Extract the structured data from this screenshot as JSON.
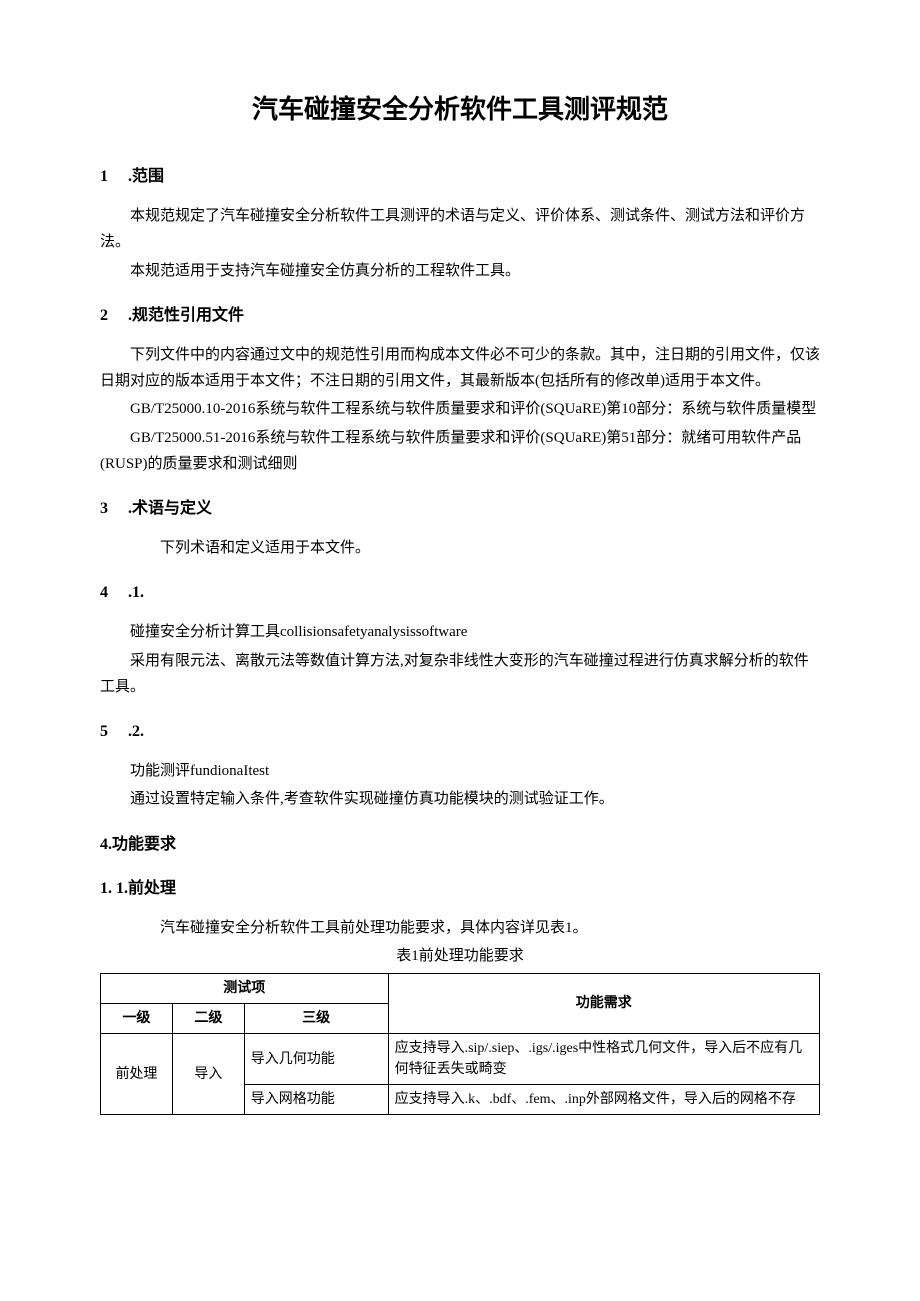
{
  "title": "汽车碰撞安全分析软件工具测评规范",
  "s1": {
    "num": "1",
    "headgap": ".",
    "head": "范围",
    "p1": "本规范规定了汽车碰撞安全分析软件工具测评的术语与定义、评价体系、测试条件、测试方法和评价方法。",
    "p2": "本规范适用于支持汽车碰撞安全仿真分析的工程软件工具。"
  },
  "s2": {
    "num": "2",
    "headgap": ".",
    "head": "规范性引用文件",
    "p1": "下列文件中的内容通过文中的规范性引用而构成本文件必不可少的条款。其中，注日期的引用文件，仅该日期对应的版本适用于本文件；不注日期的引用文件，其最新版本(包括所有的修改单)适用于本文件。",
    "p2": "GB/T25000.10-2016系统与软件工程系统与软件质量要求和评价(SQUaRE)第10部分：系统与软件质量模型",
    "p3": "GB/T25000.51-2016系统与软件工程系统与软件质量要求和评价(SQUaRE)第51部分：就绪可用软件产品(RUSP)的质量要求和测试细则"
  },
  "s3": {
    "num": "3",
    "headgap": ".",
    "head": "术语与定义",
    "p1": "下列术语和定义适用于本文件。"
  },
  "s4": {
    "num": "4",
    "suffix": ".1.",
    "p1": "碰撞安全分析计算工具collisionsafetyanalysissoftware",
    "p2": "采用有限元法、离散元法等数值计算方法,对复杂非线性大变形的汽车碰撞过程进行仿真求解分析的软件工具。"
  },
  "s5": {
    "num": "5",
    "suffix": ".2.",
    "p1": "功能测评fundionaItest",
    "p2": "通过设置特定输入条件,考查软件实现碰撞仿真功能模块的测试验证工作。"
  },
  "s6": {
    "head": "4.功能要求"
  },
  "s7": {
    "head": "1.  1.前处理",
    "p1": "汽车碰撞安全分析软件工具前处理功能要求，具体内容详见表1。",
    "caption": "表1前处理功能要求"
  },
  "table": {
    "hdr_test_item": "测试项",
    "hdr_req": "功能需求",
    "hdr_l1": "一级",
    "hdr_l2": "二级",
    "hdr_l3": "三级",
    "r1c1": "前处理",
    "r1c2": "导入",
    "r1c3": "导入几何功能",
    "r1c4": "应支持导入.sip/.siep、.igs/.iges中性格式几何文件，导入后不应有几何特征丢失或畸变",
    "r2c3": "导入网格功能",
    "r2c4": "应支持导入.k、.bdf、.fem、.inp外部网格文件，导入后的网格不存"
  }
}
